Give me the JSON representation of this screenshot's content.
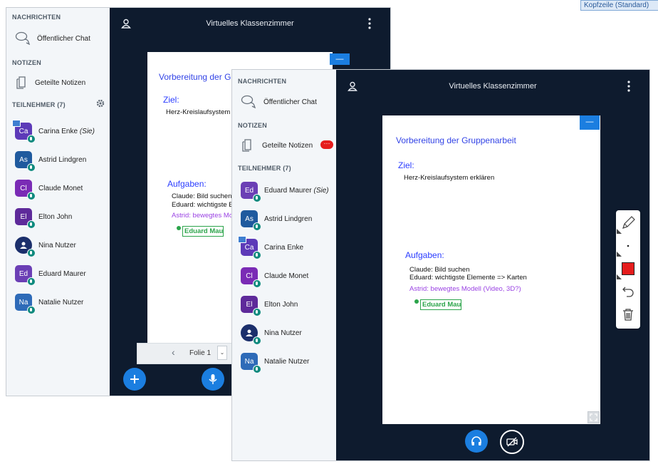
{
  "header_badge": "Kopfzeile (Standard)",
  "app_title": "Virtuelles Klassenzimmer",
  "sections": {
    "messages": "NACHRICHTEN",
    "notes": "NOTIZEN",
    "participants_back": "TEILNEHMER (7)",
    "participants_front": "TEILNEHMER (7)"
  },
  "chat_label": "Öffentlicher Chat",
  "notes_label": "Geteilte Notizen",
  "notes_badge": "···",
  "back_participants": [
    {
      "initials": "Ca",
      "name": "Carina Enke",
      "suffix": "(Sie)",
      "color": "#5d3ab8",
      "presenter": true
    },
    {
      "initials": "As",
      "name": "Astrid Lindgren",
      "suffix": "",
      "color": "#1f5a9e",
      "presenter": false
    },
    {
      "initials": "Cl",
      "name": "Claude Monet",
      "suffix": "",
      "color": "#7a2bb5",
      "presenter": false
    },
    {
      "initials": "El",
      "name": "Elton John",
      "suffix": "",
      "color": "#5e2a9a",
      "presenter": false
    },
    {
      "initials": "",
      "name": "Nina Nutzer",
      "suffix": "",
      "color": "#1b2f6b",
      "presenter": false,
      "icon": "user-glyph"
    },
    {
      "initials": "Ed",
      "name": "Eduard Maurer",
      "suffix": "",
      "color": "#6b3fb5",
      "presenter": false
    },
    {
      "initials": "Na",
      "name": "Natalie Nutzer",
      "suffix": "",
      "color": "#2e6bb8",
      "presenter": false
    }
  ],
  "front_participants": [
    {
      "initials": "Ed",
      "name": "Eduard Maurer",
      "suffix": "(Sie)",
      "color": "#6b3fb5",
      "presenter": false
    },
    {
      "initials": "As",
      "name": "Astrid Lindgren",
      "suffix": "",
      "color": "#1f5a9e",
      "presenter": false
    },
    {
      "initials": "Ca",
      "name": "Carina Enke",
      "suffix": "",
      "color": "#5d3ab8",
      "presenter": true
    },
    {
      "initials": "Cl",
      "name": "Claude Monet",
      "suffix": "",
      "color": "#7a2bb5",
      "presenter": false
    },
    {
      "initials": "El",
      "name": "Elton John",
      "suffix": "",
      "color": "#5e2a9a",
      "presenter": false
    },
    {
      "initials": "",
      "name": "Nina Nutzer",
      "suffix": "",
      "color": "#1b2f6b",
      "presenter": false,
      "icon": "user-glyph"
    },
    {
      "initials": "Na",
      "name": "Natalie Nutzer",
      "suffix": "",
      "color": "#2e6bb8",
      "presenter": false
    }
  ],
  "slide": {
    "title": "Vorbereitung der Gruppenarbeit",
    "back_title": "Vorbereitung der Gru",
    "ziel_heading": "Ziel:",
    "ziel_text": "Herz-Kreislaufsystem erklären",
    "back_ziel_text": "Herz-Kreislaufsystem e",
    "aufgaben_heading": "Aufgaben:",
    "task1": "Claude: Bild suchen",
    "task2": "Eduard: wichtigste Elemente => Karten",
    "back_task2": "Eduard: wichtigste El",
    "task3": "Astrid: bewegtes Modell (Video, 3D?)",
    "back_task3": "Astrid: bewegtes Model",
    "cursor_name": "Eduard Mau",
    "minimize": "—"
  },
  "pager": {
    "slide_label": "Folie 1"
  },
  "colors": {
    "accent": "#1b7ee0",
    "dark": "#0e1b2e",
    "red": "#e51c1c"
  },
  "icons": [
    "user-icon",
    "more-vert-icon",
    "chat-bubbles-icon",
    "notes-icon",
    "gear-icon",
    "plus-icon",
    "mic-icon",
    "headphones-icon",
    "camera-off-icon",
    "pencil-icon",
    "dot-icon",
    "color-swatch-icon",
    "undo-icon",
    "trash-icon",
    "fullscreen-icon",
    "chevron-left-icon",
    "chevron-down-icon"
  ]
}
